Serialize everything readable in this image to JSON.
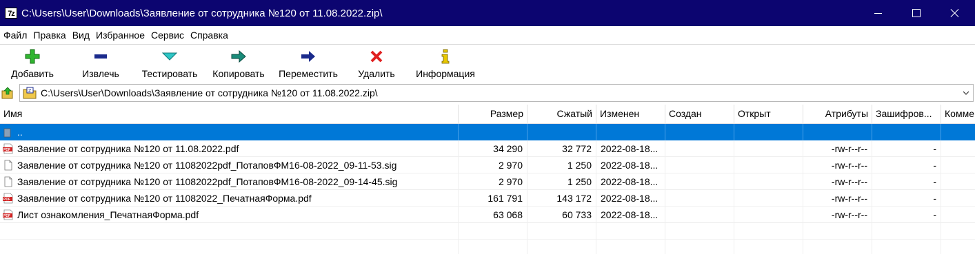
{
  "window": {
    "icon_text": "7z",
    "title": "C:\\Users\\User\\Downloads\\Заявление от сотрудника №120 от 11.08.2022.zip\\"
  },
  "menu": [
    "Файл",
    "Правка",
    "Вид",
    "Избранное",
    "Сервис",
    "Справка"
  ],
  "toolbar": {
    "add": "Добавить",
    "extract": "Извлечь",
    "test": "Тестировать",
    "copy": "Копировать",
    "move": "Переместить",
    "delete": "Удалить",
    "info": "Информация"
  },
  "colors": {
    "titlebar": "#0c0570",
    "selection": "#0078d7",
    "add_icon": "#2fb52f",
    "extract_icon": "#1a2a8c",
    "test_icon": "#2fc6c6",
    "copy_icon": "#1a8c7a",
    "move_icon": "#1a2a8c",
    "delete_icon": "#e02020",
    "info_icon": "#e8c800"
  },
  "address": {
    "path": "C:\\Users\\User\\Downloads\\Заявление от сотрудника №120 от 11.08.2022.zip\\"
  },
  "columns": {
    "name": "Имя",
    "size": "Размер",
    "packed": "Сжатый",
    "modified": "Изменен",
    "created": "Создан",
    "accessed": "Открыт",
    "attributes": "Атрибуты",
    "encrypted": "Зашифров...",
    "comment": "Комме"
  },
  "rows": [
    {
      "icon": "folder-up-icon",
      "name": "..",
      "size": "",
      "packed": "",
      "modified": "",
      "attributes": "",
      "encrypted": ""
    },
    {
      "icon": "pdf-file-icon",
      "name": "Заявление от сотрудника №120 от 11.08.2022.pdf",
      "size": "34 290",
      "packed": "32 772",
      "modified": "2022-08-18...",
      "attributes": "-rw-r--r--",
      "encrypted": "-"
    },
    {
      "icon": "file-icon",
      "name": "Заявление от сотрудника №120 от 11082022pdf_ПотаповФМ16-08-2022_09-11-53.sig",
      "size": "2 970",
      "packed": "1 250",
      "modified": "2022-08-18...",
      "attributes": "-rw-r--r--",
      "encrypted": "-"
    },
    {
      "icon": "file-icon",
      "name": "Заявление от сотрудника №120 от 11082022pdf_ПотаповФМ16-08-2022_09-14-45.sig",
      "size": "2 970",
      "packed": "1 250",
      "modified": "2022-08-18...",
      "attributes": "-rw-r--r--",
      "encrypted": "-"
    },
    {
      "icon": "pdf-file-icon",
      "name": "Заявление от сотрудника №120 от 11082022_ПечатнаяФорма.pdf",
      "size": "161 791",
      "packed": "143 172",
      "modified": "2022-08-18...",
      "attributes": "-rw-r--r--",
      "encrypted": "-"
    },
    {
      "icon": "pdf-file-icon",
      "name": "Лист ознакомления_ПечатнаяФорма.pdf",
      "size": "63 068",
      "packed": "60 733",
      "modified": "2022-08-18...",
      "attributes": "-rw-r--r--",
      "encrypted": "-"
    }
  ]
}
